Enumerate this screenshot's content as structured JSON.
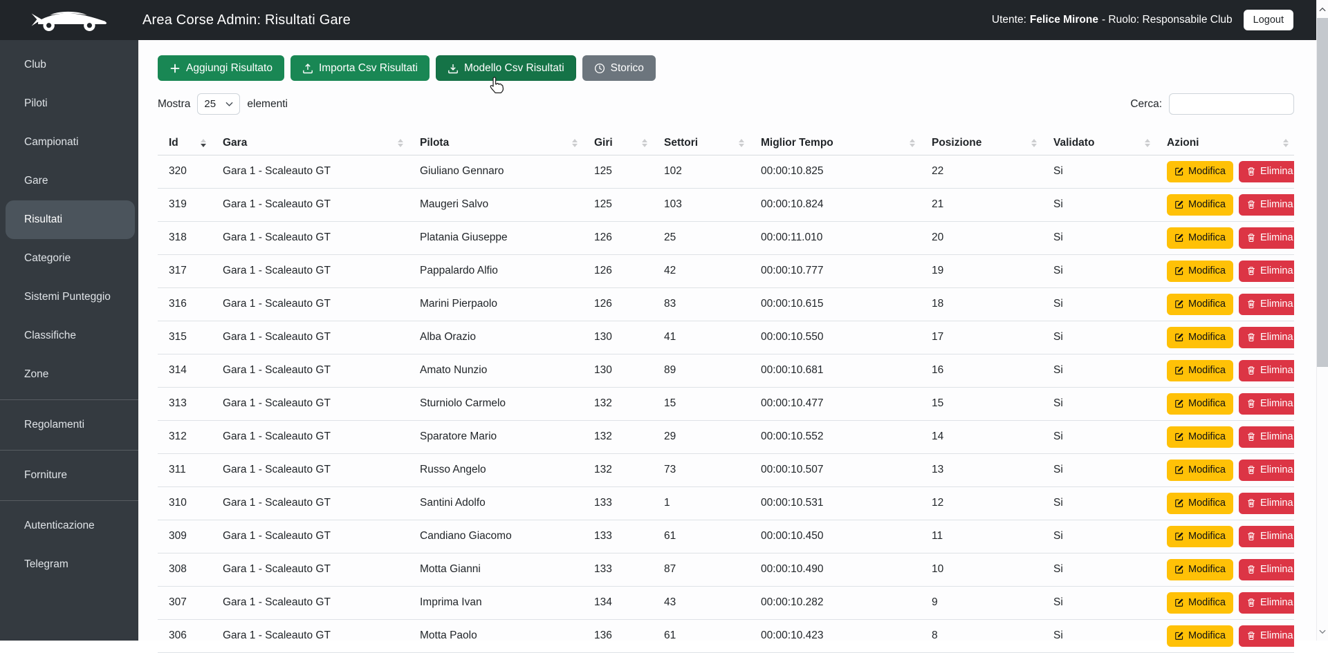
{
  "header": {
    "title": "Area Corse Admin: Risultati Gare",
    "user_label": "Utente:",
    "user_name": "Felice Mirone",
    "role_text": "- Ruolo: Responsabile Club",
    "logout": "Logout"
  },
  "sidebar": {
    "sections": [
      {
        "items": [
          {
            "label": "Club",
            "active": false
          },
          {
            "label": "Piloti",
            "active": false
          },
          {
            "label": "Campionati",
            "active": false
          },
          {
            "label": "Gare",
            "active": false
          },
          {
            "label": "Risultati",
            "active": true
          },
          {
            "label": "Categorie",
            "active": false
          },
          {
            "label": "Sistemi Punteggio",
            "active": false
          },
          {
            "label": "Classifiche",
            "active": false
          },
          {
            "label": "Zone",
            "active": false
          }
        ]
      },
      {
        "items": [
          {
            "label": "Regolamenti",
            "active": false
          }
        ]
      },
      {
        "items": [
          {
            "label": "Forniture",
            "active": false
          }
        ]
      },
      {
        "items": [
          {
            "label": "Autenticazione",
            "active": false
          },
          {
            "label": "Telegram",
            "active": false
          }
        ]
      }
    ]
  },
  "toolbar": {
    "buttons": [
      {
        "label": "Aggiungi Risultato",
        "icon": "plus-icon",
        "variant": "success"
      },
      {
        "label": "Importa Csv Risultati",
        "icon": "upload-icon",
        "variant": "success"
      },
      {
        "label": "Modello Csv Risultati",
        "icon": "download-icon",
        "variant": "success-active"
      },
      {
        "label": "Storico",
        "icon": "clock-icon",
        "variant": "secondary"
      }
    ]
  },
  "controls": {
    "show_label": "Mostra",
    "page_size": "25",
    "items_label": "elementi",
    "search_label": "Cerca:",
    "search_value": ""
  },
  "table": {
    "columns": [
      {
        "label": "Id",
        "sort": "desc"
      },
      {
        "label": "Gara",
        "sort": "none"
      },
      {
        "label": "Pilota",
        "sort": "none"
      },
      {
        "label": "Giri",
        "sort": "none"
      },
      {
        "label": "Settori",
        "sort": "none"
      },
      {
        "label": "Miglior Tempo",
        "sort": "none"
      },
      {
        "label": "Posizione",
        "sort": "none"
      },
      {
        "label": "Validato",
        "sort": "none"
      },
      {
        "label": "Azioni",
        "sort": "none"
      }
    ],
    "edit_label": "Modifica",
    "delete_label": "Elimina",
    "rows": [
      [
        "320",
        "Gara 1 - Scaleauto GT",
        "Giuliano Gennaro",
        "125",
        "102",
        "00:00:10.825",
        "22",
        "Si"
      ],
      [
        "319",
        "Gara 1 - Scaleauto GT",
        "Maugeri Salvo",
        "125",
        "103",
        "00:00:10.824",
        "21",
        "Si"
      ],
      [
        "318",
        "Gara 1 - Scaleauto GT",
        "Platania Giuseppe",
        "126",
        "25",
        "00:00:11.010",
        "20",
        "Si"
      ],
      [
        "317",
        "Gara 1 - Scaleauto GT",
        "Pappalardo Alfio",
        "126",
        "42",
        "00:00:10.777",
        "19",
        "Si"
      ],
      [
        "316",
        "Gara 1 - Scaleauto GT",
        "Marini Pierpaolo",
        "126",
        "83",
        "00:00:10.615",
        "18",
        "Si"
      ],
      [
        "315",
        "Gara 1 - Scaleauto GT",
        "Alba Orazio",
        "130",
        "41",
        "00:00:10.550",
        "17",
        "Si"
      ],
      [
        "314",
        "Gara 1 - Scaleauto GT",
        "Amato Nunzio",
        "130",
        "89",
        "00:00:10.681",
        "16",
        "Si"
      ],
      [
        "313",
        "Gara 1 - Scaleauto GT",
        "Sturniolo Carmelo",
        "132",
        "15",
        "00:00:10.477",
        "15",
        "Si"
      ],
      [
        "312",
        "Gara 1 - Scaleauto GT",
        "Sparatore Mario",
        "132",
        "29",
        "00:00:10.552",
        "14",
        "Si"
      ],
      [
        "311",
        "Gara 1 - Scaleauto GT",
        "Russo Angelo",
        "132",
        "73",
        "00:00:10.507",
        "13",
        "Si"
      ],
      [
        "310",
        "Gara 1 - Scaleauto GT",
        "Santini Adolfo",
        "133",
        "1",
        "00:00:10.531",
        "12",
        "Si"
      ],
      [
        "309",
        "Gara 1 - Scaleauto GT",
        "Candiano Giacomo",
        "133",
        "61",
        "00:00:10.450",
        "11",
        "Si"
      ],
      [
        "308",
        "Gara 1 - Scaleauto GT",
        "Motta Gianni",
        "133",
        "87",
        "00:00:10.490",
        "10",
        "Si"
      ],
      [
        "307",
        "Gara 1 - Scaleauto GT",
        "Imprima Ivan",
        "134",
        "43",
        "00:00:10.282",
        "9",
        "Si"
      ],
      [
        "306",
        "Gara 1 - Scaleauto GT",
        "Motta Paolo",
        "136",
        "61",
        "00:00:10.423",
        "8",
        "Si"
      ]
    ]
  },
  "colors": {
    "topbar_bg": "#212529",
    "sidebar_bg": "#343a40",
    "success": "#198754",
    "success_hover": "#157347",
    "secondary": "#6c757d",
    "warning": "#ffc107",
    "danger": "#dc3545",
    "border": "#dee2e6"
  }
}
